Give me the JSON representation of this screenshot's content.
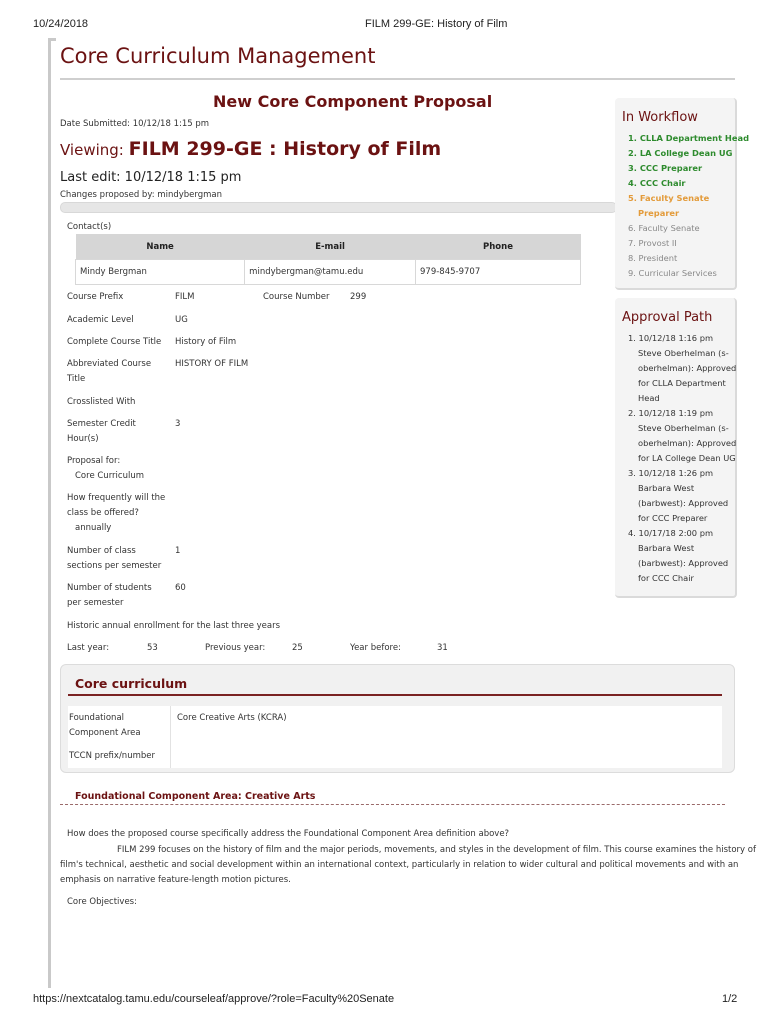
{
  "print_header": {
    "date": "10/24/2018",
    "page_title": "FILM 299-GE: History of Film"
  },
  "print_footer": {
    "url": "https://nextcatalog.tamu.edu/courseleaf/approve/?role=Faculty%20Senate",
    "page": "1/2"
  },
  "app_title": "Core Curriculum Management",
  "proposal": {
    "heading": "New Core Component Proposal",
    "date_submitted": "Date Submitted: 10/12/18 1:15 pm",
    "viewing_label": "Viewing:",
    "course": "FILM 299-GE : History of Film",
    "last_edit": "Last edit: 10/12/18 1:15 pm",
    "changes_by": "Changes proposed by: mindybergman"
  },
  "contacts": {
    "label": "Contact(s)",
    "headers": [
      "Name",
      "E-mail",
      "Phone"
    ],
    "rows": [
      [
        "Mindy Bergman",
        "mindybergman@tamu.edu",
        "979-845-9707"
      ]
    ]
  },
  "fields": {
    "course_prefix_label": "Course Prefix",
    "course_prefix": "FILM",
    "course_number_label": "Course Number",
    "course_number": "299",
    "academic_level_label": "Academic Level",
    "academic_level": "UG",
    "complete_title_label": "Complete Course Title",
    "complete_title": "History of Film",
    "abbrev_title_label_1": "Abbreviated Course",
    "abbrev_title_label_2": "Title",
    "abbrev_title": "HISTORY OF FILM",
    "crosslisted_label": "Crosslisted With",
    "credit_label_1": "Semester Credit",
    "credit_label_2": "Hour(s)",
    "credit": "3",
    "proposal_for_label": "Proposal for:",
    "proposal_for": "Core Curriculum",
    "frequency_label_1": "How frequently will the",
    "frequency_label_2": "class be offered?",
    "frequency": "annually",
    "sections_label_1": "Number of class",
    "sections_label_2": "sections per semester",
    "sections": "1",
    "students_label_1": "Number of students",
    "students_label_2": "per semester",
    "students": "60",
    "enrollment_label": "Historic annual enrollment for the last three years",
    "last_year_label": "Last year:",
    "last_year": "53",
    "previous_year_label": "Previous year:",
    "previous_year": "25",
    "year_before_label": "Year before:",
    "year_before": "31"
  },
  "core": {
    "title": "Core curriculum",
    "fca_label_1": "Foundational",
    "fca_label_2": "Component Area",
    "fca_value": "Core Creative Arts (KCRA)",
    "tccn_label": "TCCN prefix/number"
  },
  "fca_section": {
    "title": "Foundational Component Area: Creative Arts",
    "question": "How does the proposed course specifically address the Foundational Component Area definition above?",
    "answer_1": "FILM 299 focuses on the history of film and the major periods, movements, and styles in the development of film. This course examines the history of",
    "answer_2": "film's technical, aesthetic and social development within an international context, particularly in relation to wider cultural and political movements and with an",
    "answer_3": "emphasis on narrative feature-length motion pictures.",
    "objectives_label": "Core Objectives:"
  },
  "workflow": {
    "title": "In Workflow",
    "steps": [
      "1. CLLA Department Head",
      "2. LA College Dean UG",
      "3. CCC Preparer",
      "4. CCC Chair",
      "5. Faculty Senate",
      "Preparer",
      "6. Faculty Senate",
      "7. Provost II",
      "8. President",
      "9. Curricular Services"
    ],
    "colors": {
      "completed": "#2e8b2e",
      "current": "#e39b3a",
      "pending": "#888888"
    }
  },
  "approval_path": {
    "title": "Approval Path",
    "lines": [
      "1. 10/12/18 1:16 pm",
      "Steve Oberhelman (s-",
      "oberhelman): Approved",
      "for CLLA Department",
      "Head",
      "2. 10/12/18 1:19 pm",
      "Steve Oberhelman (s-",
      "oberhelman): Approved",
      "for LA College Dean UG",
      "3. 10/12/18 1:26 pm",
      "Barbara West",
      "(barbwest): Approved",
      "for CCC Preparer",
      "4. 10/17/18 2:00 pm",
      "Barbara West",
      "(barbwest): Approved",
      "for CCC Chair"
    ]
  }
}
